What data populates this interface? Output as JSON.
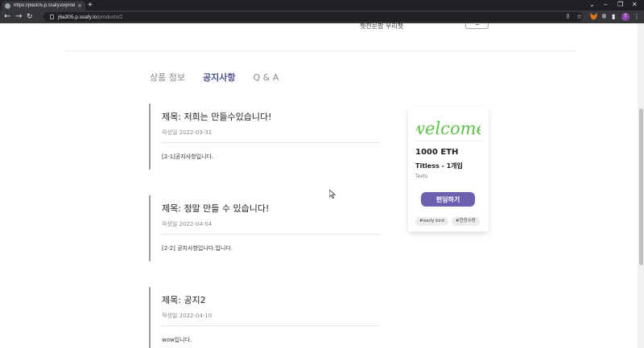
{
  "browser": {
    "tab_title": "https://j6a305.p.ssafy.io/product",
    "tab_close": "×",
    "new_tab": "+",
    "url_host": "j6a305.p.ssafy.io",
    "url_path": "/products/2",
    "profile_initial": "T",
    "window_controls": [
      "⌄",
      "–",
      "❐",
      "✕"
    ]
  },
  "page": {
    "top_text": "펫전문팝 우리펫",
    "tabs": [
      {
        "label": "상품 정보",
        "active": false
      },
      {
        "label": "공지사항",
        "active": true
      },
      {
        "label": "Q & A",
        "active": false
      }
    ],
    "notices": [
      {
        "title": "제목: 저희는 만들수있습니다!",
        "date": "작성일 2022-03-31",
        "body": "[2-1]공지사항입니다."
      },
      {
        "title": "제목: 정말 만들 수 있습니다!",
        "date": "작성일 2022-04-04",
        "body": "[2-2] 공지사항입니다.입니다."
      },
      {
        "title": "제목: 공지2",
        "date": "작성일 2022-04-10",
        "body": "wow입니다."
      }
    ],
    "card": {
      "welcome_text": "welcome",
      "price": "1000 ETH",
      "tier": "Titless - 1개입",
      "description": "Texts",
      "fund_button": "펀딩하기",
      "tags": [
        "#early bird",
        "#한정수량"
      ]
    }
  },
  "colors": {
    "accent": "#6e5fb0",
    "active_tab": "#4a4f8a",
    "welcome_green": "#5cbf45"
  }
}
